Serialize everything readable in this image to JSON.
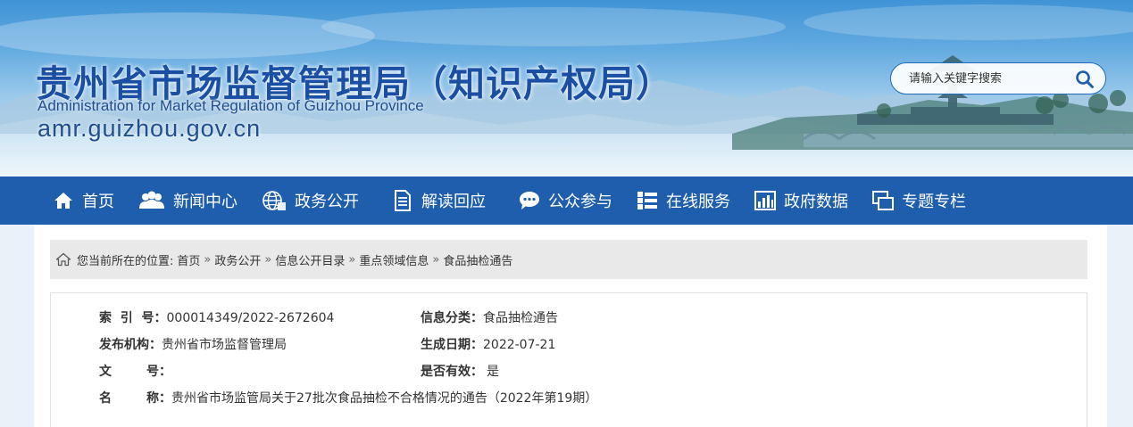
{
  "header": {
    "title": "贵州省市场监督管理局（知识产权局）",
    "subtitle": "Administration for Market Regulation of Guizhou Province",
    "domain": "amr.guizhou.gov.cn",
    "search_placeholder": "请输入关键字搜索",
    "search_icon": "search-icon"
  },
  "nav": {
    "items": [
      {
        "label": "首页",
        "icon": "home-icon"
      },
      {
        "label": "新闻中心",
        "icon": "users-icon"
      },
      {
        "label": "政务公开",
        "icon": "globe-icon"
      },
      {
        "label": "解读回应",
        "icon": "document-icon"
      },
      {
        "label": "公众参与",
        "icon": "chat-icon"
      },
      {
        "label": "在线服务",
        "icon": "list-icon"
      },
      {
        "label": "政府数据",
        "icon": "bar-chart-icon"
      },
      {
        "label": "专题专栏",
        "icon": "windows-icon"
      }
    ]
  },
  "breadcrumb": {
    "prefix": "您当前所在的位置:",
    "items": [
      "首页",
      "政务公开",
      "信息公开目录",
      "重点领域信息",
      "食品抽检通告"
    ],
    "separator": "»"
  },
  "info": {
    "index_label": "索  引  号：",
    "index_value": "000014349/2022-2672604",
    "category_label": "信息分类：",
    "category_value": "食品抽检通告",
    "publisher_label": "发布机构：",
    "publisher_value": "贵州省市场监督管理局",
    "date_label": "生成日期：",
    "date_value": "2022-07-21",
    "docno_label": "文        号：",
    "docno_value": "",
    "valid_label": "是否有效：",
    "valid_value": "是",
    "name_label": "名        称：",
    "name_value": "贵州省市场监管局关于27批次食品抽检不合格情况的通告（2022年第19期）"
  },
  "colors": {
    "nav_bg": "#1f5ead",
    "title": "#1a4fa3",
    "breadcrumb_bg": "#e9e9e9"
  }
}
